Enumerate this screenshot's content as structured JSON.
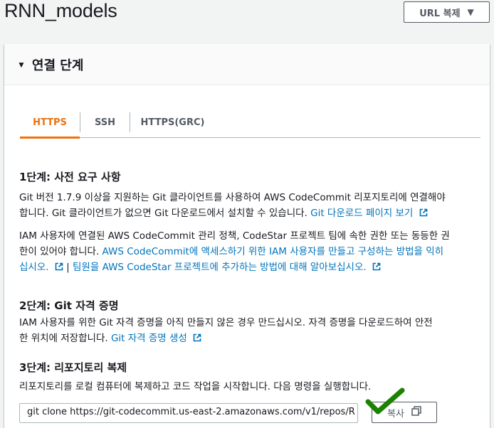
{
  "repo": {
    "title": "RNN_models"
  },
  "header_actions": {
    "url_clone_label": "URL 복제"
  },
  "panel": {
    "title": "연결 단계",
    "tabs": [
      {
        "label": "HTTPS",
        "active": true
      },
      {
        "label": "SSH",
        "active": false
      },
      {
        "label": "HTTPS(GRC)",
        "active": false
      }
    ]
  },
  "step1": {
    "title": "1단계: 사전 요구 사항",
    "p1_line1": "Git 버전 1.7.9 이상을 지원하는 Git 클라이언트를 사용하여 AWS CodeCommit 리포지토리에 연결해야",
    "p1_line2": "합니다. Git 클라이언트가 없으면 Git 다운로드에서 설치할 수 있습니다.",
    "p1_link": "Git 다운로드 페이지 보기",
    "p2_line1": "IAM 사용자에 연결된 AWS CodeCommit 관리 정책, CodeStar 프로젝트 팀에 속한 권한 또는 동등한 권",
    "p2_line2": "한이 있어야 합니다.",
    "p2_link1_a": "AWS CodeCommit에 액세스하기 위한 IAM 사용자를 만들고 구성하는 방법을 익히",
    "p2_link1_b": "십시오.",
    "p2_sep": "|",
    "p2_link2": "팀원을 AWS CodeStar 프로젝트에 추가하는 방법에 대해 알아보십시오."
  },
  "step2": {
    "title": "2단계: Git 자격 증명",
    "line1": "IAM 사용자를 위한 Git 자격 증명을 아직 만들지 않은 경우 만드십시오. 자격 증명을 다운로드하여 안전",
    "line2": "한 위치에 저장합니다.",
    "link": "Git 자격 증명 생성"
  },
  "step3": {
    "title": "3단계: 리포지토리 복제",
    "desc": "리포지토리를 로컬 컴퓨터에 복제하고 코드 작업을 시작합니다. 다음 명령을 실행합니다.",
    "command": "git clone https://git-codecommit.us-east-2.amazonaws.com/v1/repos/R",
    "copy_label": "복사"
  },
  "colors": {
    "accent": "#ec7211",
    "link": "#0073bb",
    "check": "#1d8102"
  }
}
